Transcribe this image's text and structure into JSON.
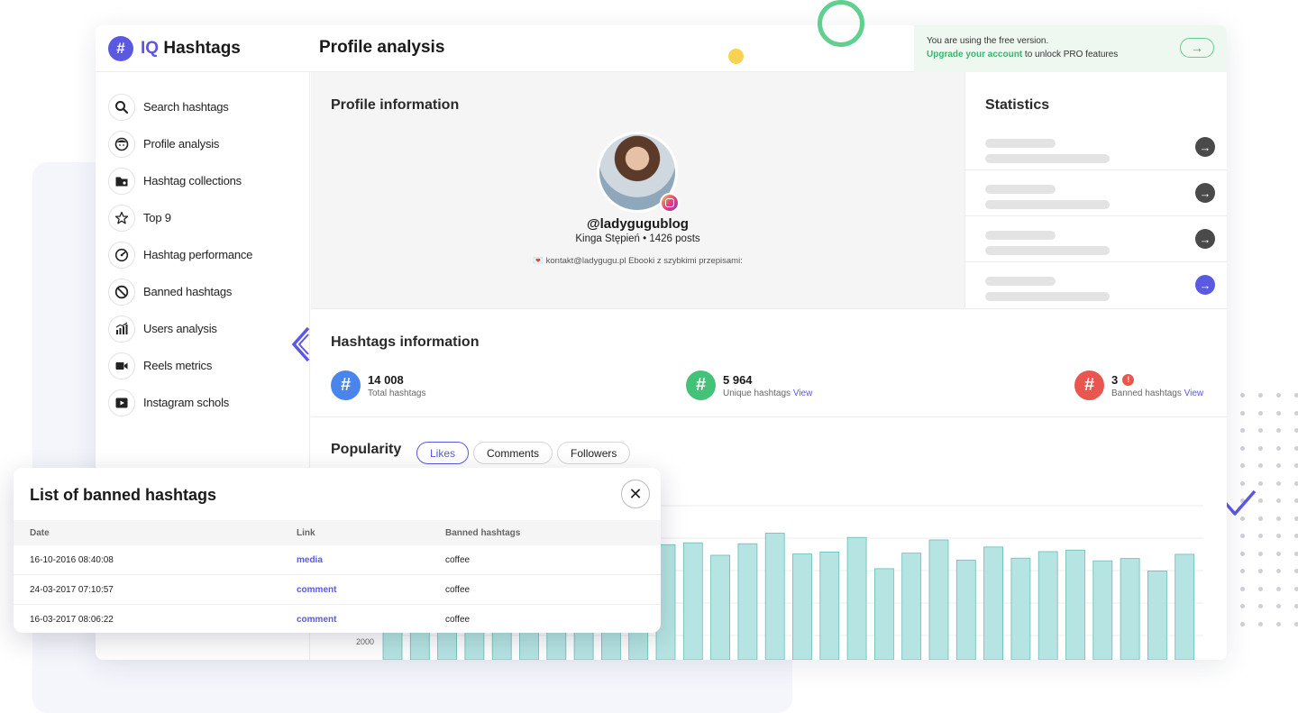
{
  "brand": {
    "prefix": "IQ",
    "name": "Hashtags",
    "mark": "#"
  },
  "header": {
    "title": "Profile analysis",
    "promo_line1": "You are using the free version.",
    "promo_upgrade": "Upgrade your account",
    "promo_rest": "to unlock PRO features",
    "promo_arrow": "→"
  },
  "sidebar": {
    "items": [
      {
        "label": "Search hashtags",
        "icon": "search-icon"
      },
      {
        "label": "Profile analysis",
        "icon": "face-icon"
      },
      {
        "label": "Hashtag collections",
        "icon": "folder-icon"
      },
      {
        "label": "Top 9",
        "icon": "star-icon"
      },
      {
        "label": "Hashtag performance",
        "icon": "gauge-icon"
      },
      {
        "label": "Banned hashtags",
        "icon": "ban-icon"
      },
      {
        "label": "Users analysis",
        "icon": "bar-chart-icon"
      },
      {
        "label": "Reels metrics",
        "icon": "video-camera-icon"
      },
      {
        "label": "Instagram schols",
        "icon": "play-icon"
      }
    ]
  },
  "profile": {
    "section_title": "Profile information",
    "username": "@ladygugublog",
    "fullname": "Kinga Stępień • 1426 posts",
    "bio": "💌 kontakt@ladygugu.pl Ebooki z szybkimi przepisami:"
  },
  "statistics": {
    "title": "Statistics",
    "rows": 4
  },
  "hashtags_info": {
    "title": "Hashtags information",
    "total": {
      "value": "14 008",
      "label": "Total hashtags",
      "color": "#4a85ec"
    },
    "unique": {
      "value": "5 964",
      "label": "Unique hashtags",
      "link": "View",
      "color": "#45c27a"
    },
    "banned": {
      "value": "3",
      "label": "Banned hashtags",
      "link": "View",
      "color": "#e8564f",
      "warn": "!"
    }
  },
  "popularity": {
    "title": "Popularity",
    "tabs": [
      "Likes",
      "Comments",
      "Followers"
    ],
    "active_tab": "Likes"
  },
  "chart_data": {
    "type": "bar",
    "y_tick_visible": "2000",
    "values": [
      2000,
      2000,
      2000,
      2000,
      2000,
      2000,
      2000,
      2000,
      2000,
      2000,
      6000,
      6100,
      5450,
      6050,
      6600,
      5520,
      5620,
      6380,
      4750,
      5560,
      6250,
      5200,
      5880,
      5300,
      5640,
      5720,
      5160,
      5280,
      4630,
      5500
    ],
    "bar_color": "#b5e4e2",
    "bar_stroke": "#68bdb6"
  },
  "modal": {
    "title": "List of banned hashtags",
    "close": "✕",
    "columns": [
      "Date",
      "Link",
      "Banned hashtags"
    ],
    "rows": [
      {
        "date": "16-10-2016 08:40:08",
        "link": "media",
        "hashtag": "coffee"
      },
      {
        "date": "24-03-2017 07:10:57",
        "link": "comment",
        "hashtag": "coffee"
      },
      {
        "date": "16-03-2017 08:06:22",
        "link": "comment",
        "hashtag": "coffee"
      }
    ]
  }
}
